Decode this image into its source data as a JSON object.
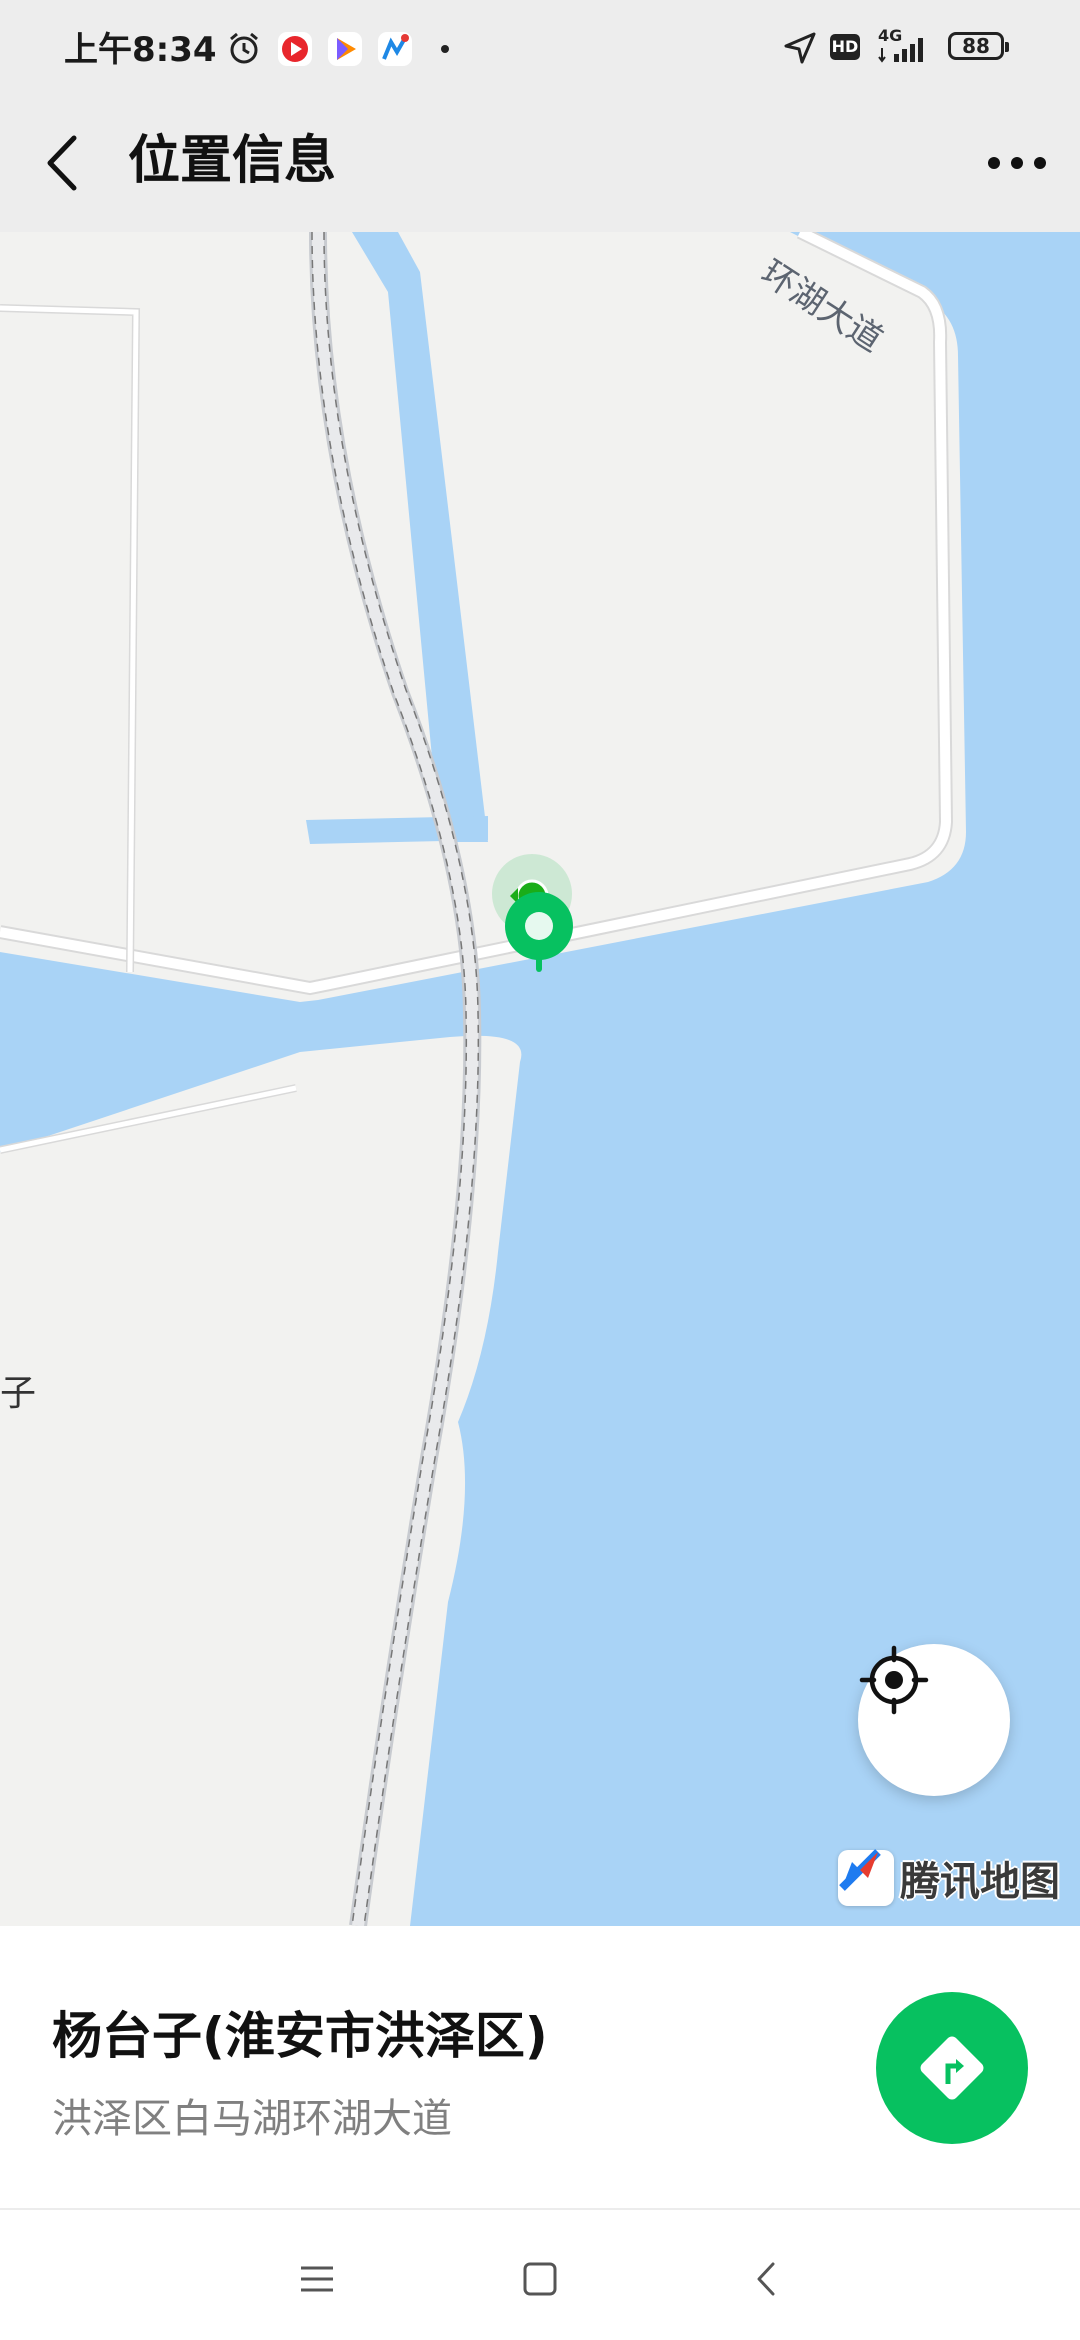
{
  "status_bar": {
    "time": "上午8:34",
    "network": "4G",
    "hd": "HD",
    "battery": "88",
    "left_icons": [
      "alarm-icon",
      "video-app-icon",
      "play-app-icon",
      "map-app-icon",
      "dot-icon"
    ],
    "right_icons": [
      "location-arrow-icon",
      "hd-icon",
      "signal-icon",
      "battery-icon"
    ]
  },
  "nav": {
    "title": "位置信息",
    "back_icon": "chevron-left-icon",
    "more_icon": "more-dots-icon"
  },
  "map": {
    "road_label": "环湖大道",
    "place_fragment": "子",
    "brand": "腾讯地图",
    "colors": {
      "water": "#a9d3f6",
      "land": "#f2f2f0",
      "road": "#ffffff",
      "pin": "#07c160"
    }
  },
  "place": {
    "name": "杨台子(淮安市洪泽区)",
    "address": "洪泽区白马湖环湖大道"
  },
  "system_nav": {
    "icons": [
      "menu-icon",
      "home-square-icon",
      "back-triangle-icon"
    ]
  }
}
